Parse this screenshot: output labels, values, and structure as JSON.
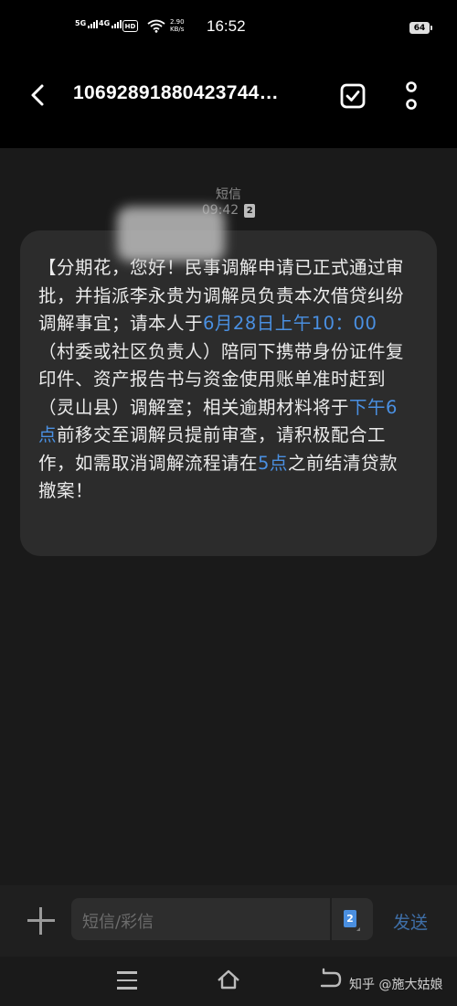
{
  "status_bar": {
    "signal1_label": "5G",
    "signal2_label": "4G",
    "hd_badge": "HD",
    "net_speed_value": "2.90",
    "net_speed_unit": "KB/s",
    "time": "16:52",
    "battery": "64"
  },
  "header": {
    "title": "10692891880423744…",
    "icons": {
      "back": "back-arrow-icon",
      "select": "check-box-icon",
      "more": "more-vertical-icon"
    }
  },
  "conversation": {
    "channel_label": "短信",
    "time": "09:42",
    "sim_badge": "2",
    "message_parts": [
      {
        "text": "【分期花",
        "highlight": false
      },
      {
        "text": "，您好！民事调解申请已正式通过审批，并指派李永贵为调解员负责本次借贷纠纷调解事宜；请本人于",
        "highlight": false
      },
      {
        "text": "6月28日上午10：00",
        "highlight": true
      },
      {
        "text": "（村委或社区负责人）陪同下携带身份证件复印件、资产报告书与资金使用账单准时赶到（灵山县）调解室；相关逾期材料将于",
        "highlight": false
      },
      {
        "text": "下午6点",
        "highlight": true
      },
      {
        "text": "前移交至调解员提前审查，请积极配合工作，如需取消调解流程请在",
        "highlight": false
      },
      {
        "text": "5点",
        "highlight": true
      },
      {
        "text": "之前结清贷款撤案！",
        "highlight": false
      }
    ],
    "colors": {
      "highlight": "#4a90e2",
      "bubble": "#2c2c2c"
    }
  },
  "composer": {
    "placeholder": "短信/彩信",
    "sim_button_label": "2",
    "send_label": "发送"
  },
  "nav_bar": {
    "watermark": "知乎 @施大姑娘"
  }
}
